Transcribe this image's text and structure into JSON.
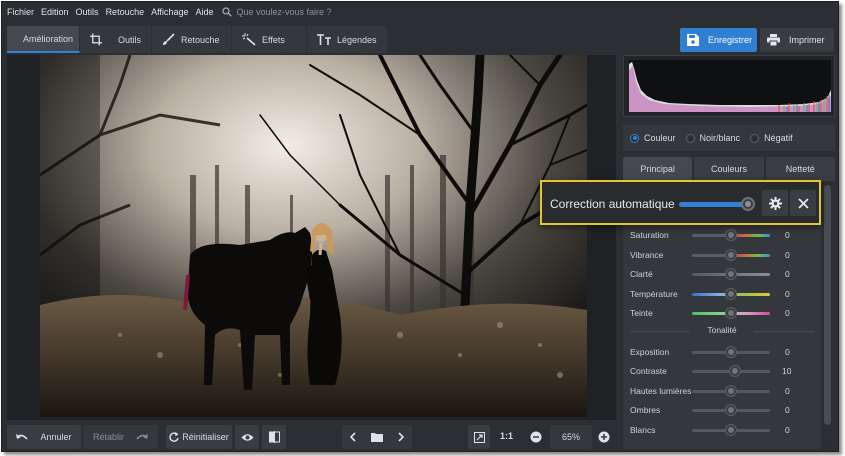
{
  "menu": {
    "items": [
      "Fichier",
      "Edition",
      "Outils",
      "Retouche",
      "Affichage",
      "Aide"
    ],
    "search_placeholder": "Que voulez-vous faire ?"
  },
  "toolbar": {
    "tabs": [
      {
        "label": "Amélioration",
        "icon": "sliders-icon",
        "active": true
      },
      {
        "label": "Outils",
        "icon": "crop-icon",
        "active": false
      },
      {
        "label": "Retouche",
        "icon": "brush-icon",
        "active": false
      },
      {
        "label": "Effets",
        "icon": "magic-wand-icon",
        "active": false
      },
      {
        "label": "Légendes",
        "icon": "text-icon",
        "active": false
      }
    ],
    "save_label": "Enregistrer",
    "print_label": "Imprimer"
  },
  "bottom": {
    "undo_label": "Annuler",
    "redo_label": "Rétablir",
    "reset_label": "Réinitialiser",
    "ratio_label": "1:1",
    "zoom_value": "65%"
  },
  "panel": {
    "modes": [
      {
        "label": "Couleur",
        "selected": true
      },
      {
        "label": "Noir/blanc",
        "selected": false
      },
      {
        "label": "Négatif",
        "selected": false
      }
    ],
    "tabs": [
      {
        "label": "Principal",
        "active": true
      },
      {
        "label": "Couleurs",
        "active": false
      },
      {
        "label": "Netteté",
        "active": false
      }
    ],
    "color_sliders": [
      {
        "label": "Saturation",
        "value": "0",
        "level": 0.5
      },
      {
        "label": "Vibrance",
        "value": "0",
        "level": 0.5
      },
      {
        "label": "Clarté",
        "value": "0",
        "level": 0.5
      },
      {
        "label": "Température",
        "value": "0",
        "level": 0.5
      },
      {
        "label": "Teinte",
        "value": "0",
        "level": 0.5
      }
    ],
    "tonality_title": "Tonalité",
    "tonality_sliders": [
      {
        "label": "Exposition",
        "value": "0",
        "level": 0.5
      },
      {
        "label": "Contraste",
        "value": "10",
        "level": 0.55
      },
      {
        "label": "Hautes lumières",
        "value": "0",
        "level": 0.5
      },
      {
        "label": "Ombres",
        "value": "0",
        "level": 0.5
      },
      {
        "label": "Blancs",
        "value": "0",
        "level": 0.5
      }
    ]
  },
  "popup": {
    "label": "Correction automatique",
    "level": 1.0
  },
  "colors": {
    "accent": "#2f82d8",
    "highlight_border": "#e4c629",
    "background": "#2b2e33"
  }
}
